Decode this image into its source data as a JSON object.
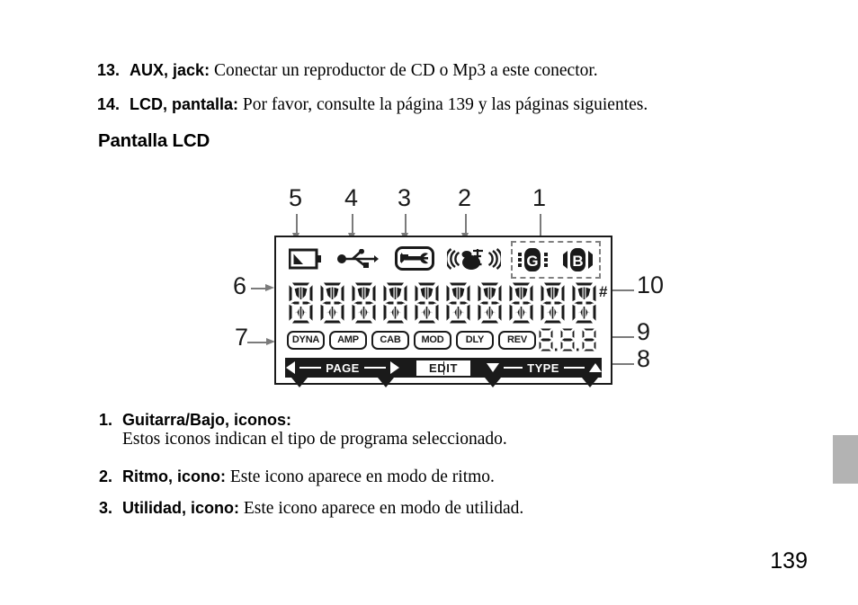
{
  "document": {
    "page_number": "139",
    "edge_tab_color": "#b3b3b3"
  },
  "top_list": [
    {
      "number": "13.",
      "term": "AUX, jack:",
      "description": "Conectar un reproductor de CD o Mp3 a este conector."
    },
    {
      "number": "14.",
      "term": "LCD, pantalla:",
      "description": "Por favor, consulte la página 139 y las páginas siguientes."
    }
  ],
  "section_title": "Pantalla LCD",
  "bottom_list": [
    {
      "number": "1.",
      "term": "Guitarra/Bajo, iconos:",
      "description": "Estos iconos indican el tipo de programa seleccionado."
    },
    {
      "number": "2.",
      "term": "Ritmo, icono:",
      "description": "Este icono aparece en modo de ritmo."
    },
    {
      "number": "3.",
      "term": "Utilidad, icono:",
      "description": "Este icono aparece en modo de utilidad."
    }
  ],
  "lcd_diagram": {
    "callouts_top": [
      {
        "label": "5",
        "target": "battery-icon"
      },
      {
        "label": "4",
        "target": "usb-icon"
      },
      {
        "label": "3",
        "target": "utility-wrench-icon"
      },
      {
        "label": "2",
        "target": "rhythm-drum-icon"
      },
      {
        "label": "1",
        "target": "guitar-bass-icons"
      }
    ],
    "callouts_left": [
      {
        "label": "6",
        "target": "segment-character-row"
      },
      {
        "label": "7",
        "target": "effect-block-row"
      }
    ],
    "callouts_right": [
      {
        "label": "10",
        "target": "sharp-symbol"
      },
      {
        "label": "9",
        "target": "numeric-display"
      },
      {
        "label": "8",
        "target": "navigation-bar"
      }
    ],
    "icons": [
      {
        "name": "battery-icon",
        "semantic": "battery"
      },
      {
        "name": "usb-icon",
        "semantic": "usb"
      },
      {
        "name": "utility-wrench-icon",
        "semantic": "wrench"
      },
      {
        "name": "rhythm-drum-icon",
        "semantic": "drum-kit"
      },
      {
        "name": "guitar-icon",
        "label": "G"
      },
      {
        "name": "bass-icon",
        "label": "B"
      }
    ],
    "segment_display": {
      "character_count": 10,
      "sharp_symbol": "#"
    },
    "effect_blocks": [
      "DYNA",
      "AMP",
      "CAB",
      "MOD",
      "DLY",
      "REV"
    ],
    "numeric_display": "8.8.8",
    "nav_bar": {
      "page_label": "PAGE",
      "edit_label": "EDIT",
      "type_label": "TYPE"
    }
  }
}
